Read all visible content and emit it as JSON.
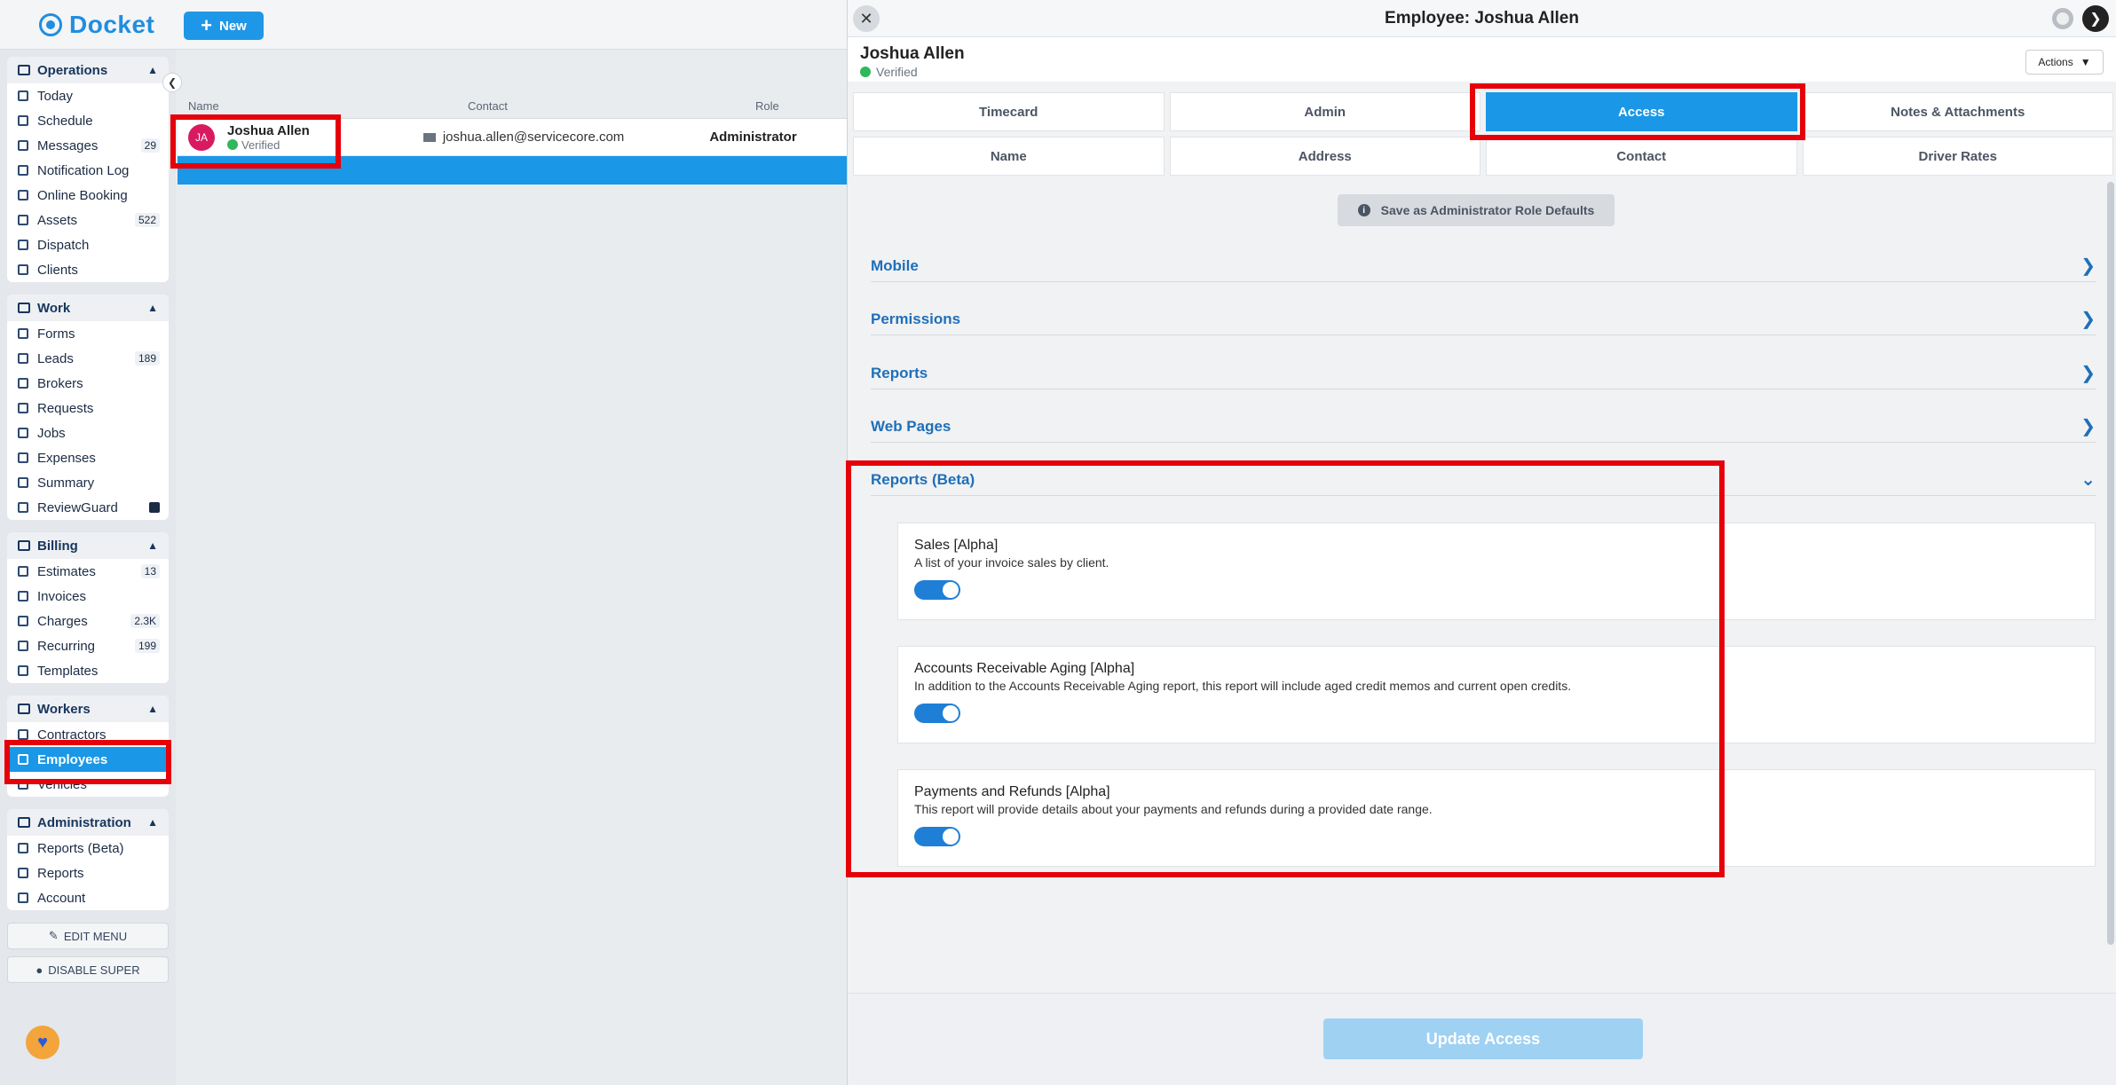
{
  "app": {
    "name": "Docket",
    "new_label": "New"
  },
  "sidebar": {
    "groups": [
      {
        "title": "Operations",
        "items": [
          {
            "label": "Today",
            "badge": ""
          },
          {
            "label": "Schedule",
            "badge": ""
          },
          {
            "label": "Messages",
            "badge": "29"
          },
          {
            "label": "Notification Log",
            "badge": ""
          },
          {
            "label": "Online Booking",
            "badge": ""
          },
          {
            "label": "Assets",
            "badge": "522"
          },
          {
            "label": "Dispatch",
            "badge": ""
          },
          {
            "label": "Clients",
            "badge": ""
          }
        ]
      },
      {
        "title": "Work",
        "items": [
          {
            "label": "Forms",
            "badge": ""
          },
          {
            "label": "Leads",
            "badge": "189"
          },
          {
            "label": "Brokers",
            "badge": ""
          },
          {
            "label": "Requests",
            "badge": ""
          },
          {
            "label": "Jobs",
            "badge": ""
          },
          {
            "label": "Expenses",
            "badge": ""
          },
          {
            "label": "Summary",
            "badge": ""
          },
          {
            "label": "ReviewGuard",
            "badge": ""
          }
        ]
      },
      {
        "title": "Billing",
        "items": [
          {
            "label": "Estimates",
            "badge": "13"
          },
          {
            "label": "Invoices",
            "badge": ""
          },
          {
            "label": "Charges",
            "badge": "2.3K"
          },
          {
            "label": "Recurring",
            "badge": "199"
          },
          {
            "label": "Templates",
            "badge": ""
          }
        ]
      },
      {
        "title": "Workers",
        "items": [
          {
            "label": "Contractors",
            "badge": ""
          },
          {
            "label": "Employees",
            "badge": ""
          },
          {
            "label": "Vehicles",
            "badge": ""
          }
        ]
      },
      {
        "title": "Administration",
        "items": [
          {
            "label": "Reports (Beta)",
            "badge": ""
          },
          {
            "label": "Reports",
            "badge": ""
          },
          {
            "label": "Account",
            "badge": ""
          }
        ]
      }
    ],
    "edit_menu": "EDIT MENU",
    "disable_super": "DISABLE SUPER"
  },
  "list": {
    "columns": [
      "Name",
      "Contact",
      "Role"
    ],
    "rows": [
      {
        "initials": "JA",
        "name": "Joshua Allen",
        "status": "Verified",
        "email": "joshua.allen@servicecore.com",
        "role": "Administrator"
      }
    ]
  },
  "panel": {
    "title": "Employee: Joshua Allen",
    "employee_name": "Joshua Allen",
    "employee_status": "Verified",
    "actions_label": "Actions",
    "tabs_primary": [
      "Timecard",
      "Admin",
      "Access",
      "Notes & Attachments"
    ],
    "tabs_secondary": [
      "Name",
      "Address",
      "Contact",
      "Driver Rates"
    ],
    "save_defaults_label": "Save as Administrator Role Defaults",
    "sections": [
      "Mobile",
      "Permissions",
      "Reports",
      "Web Pages",
      "Reports (Beta)"
    ],
    "reports": [
      {
        "title": "Sales [Alpha]",
        "description": "A list of your invoice sales by client.",
        "enabled": true
      },
      {
        "title": "Accounts Receivable Aging [Alpha]",
        "description": "In addition to the Accounts Receivable Aging report, this report will include aged credit memos and current open credits.",
        "enabled": true
      },
      {
        "title": "Payments and Refunds [Alpha]",
        "description": "This report will provide details about your payments and refunds during a provided date range.",
        "enabled": true
      }
    ],
    "update_label": "Update Access"
  },
  "colors": {
    "accent": "#1a97e6",
    "highlight": "#e6000a",
    "section_link": "#1f6fb8"
  }
}
